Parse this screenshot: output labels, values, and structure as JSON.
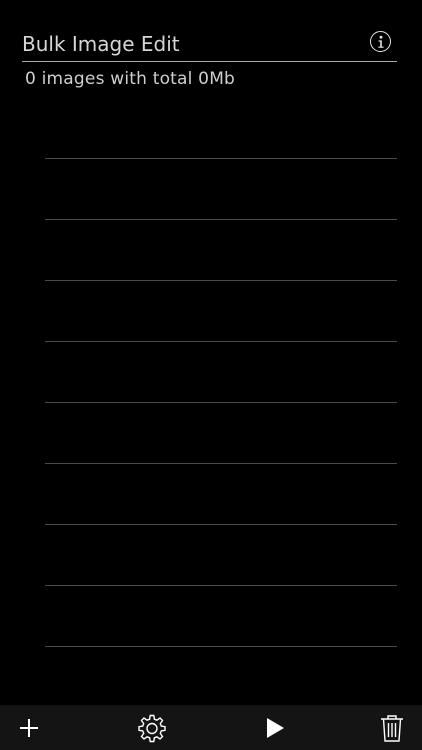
{
  "header": {
    "title": "Bulk Image Edit",
    "info_icon": "info-icon"
  },
  "summary": {
    "text": "0 images with total 0Mb"
  },
  "list": {
    "rows": [
      "",
      "",
      "",
      "",
      "",
      "",
      "",
      "",
      ""
    ]
  },
  "toolbar": {
    "items": [
      {
        "icon": "add-icon"
      },
      {
        "icon": "gear-icon"
      },
      {
        "icon": "play-icon"
      },
      {
        "icon": "trash-icon"
      }
    ]
  },
  "colors": {
    "background": "#000000",
    "toolbar": "#141414",
    "text": "#d9d9d9",
    "divider": "#4a4a4a"
  }
}
